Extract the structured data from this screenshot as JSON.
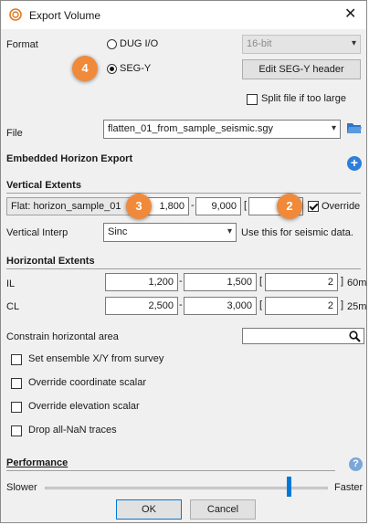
{
  "window": {
    "title": "Export Volume",
    "close_glyph": "✕"
  },
  "format": {
    "label": "Format",
    "option_dug": "DUG I/O",
    "option_segy": "SEG-Y",
    "selected": "SEG-Y",
    "bit_depth": "16-bit",
    "edit_segy_header": "Edit SEG-Y header",
    "split_file_label": "Split file if too large",
    "split_file_checked": false
  },
  "file": {
    "label": "File",
    "value": "flatten_01_from_sample_seismic.sgy"
  },
  "embedded_horizon": {
    "title": "Embedded Horizon Export"
  },
  "vertical": {
    "title": "Vertical Extents",
    "flat_label": "Flat: horizon_sample_01",
    "start": "1,800",
    "end": "9,000",
    "step": "",
    "override_label": "Override",
    "override_checked": true,
    "interp_label": "Vertical Interp",
    "interp_value": "Sinc",
    "interp_hint": "Use this for seismic data."
  },
  "horizontal": {
    "title": "Horizontal Extents",
    "il": {
      "label": "IL",
      "start": "1,200",
      "end": "1,500",
      "step": "2",
      "unit": "60m"
    },
    "cl": {
      "label": "CL",
      "start": "2,500",
      "end": "3,000",
      "step": "2",
      "unit": "25m"
    },
    "constrain_label": "Constrain horizontal area"
  },
  "options": [
    {
      "label": "Set ensemble X/Y from survey",
      "checked": false
    },
    {
      "label": "Override coordinate scalar",
      "checked": false
    },
    {
      "label": "Override elevation scalar",
      "checked": false
    },
    {
      "label": "Drop all-NaN traces",
      "checked": false
    }
  ],
  "performance": {
    "title": "Performance",
    "slower": "Slower",
    "faster": "Faster",
    "level": 0.86
  },
  "buttons": {
    "ok": "OK",
    "cancel": "Cancel"
  },
  "annotations": {
    "badge_2": "2",
    "badge_3": "3",
    "badge_4": "4"
  },
  "colors": {
    "badge": "#f08a3a",
    "accent": "#0078d7"
  }
}
